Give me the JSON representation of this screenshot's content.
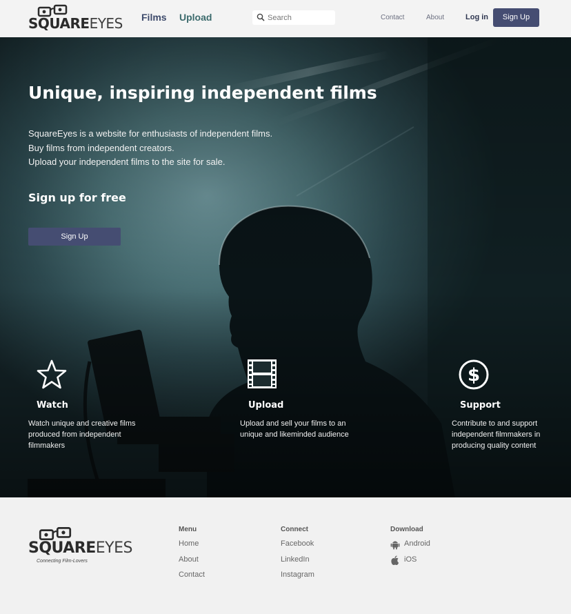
{
  "header": {
    "logo_main": "SQUARE",
    "logo_eyes": "EYES",
    "nav": {
      "films": "Films",
      "upload": "Upload"
    },
    "search": {
      "placeholder": "Search"
    },
    "links": {
      "contact": "Contact",
      "about": "About"
    },
    "login": "Log in",
    "signup": "Sign Up"
  },
  "hero": {
    "title": "Unique, inspiring independent films",
    "lines": [
      "SquareEyes is a website for enthusiasts of independent films.",
      "Buy films from independent creators.",
      "Upload your independent films to the site for sale."
    ],
    "subtitle": "Sign up for free",
    "button": "Sign Up"
  },
  "features": [
    {
      "icon": "star-icon",
      "title": "Watch",
      "desc": "Watch unique and creative films produced from independent filmmakers"
    },
    {
      "icon": "film-icon",
      "title": "Upload",
      "desc": "Upload and sell your films to an unique and likeminded audience"
    },
    {
      "icon": "dollar-icon",
      "title": "Support",
      "desc": "Contribute to and support independent filmmakers in producing quality content"
    }
  ],
  "footer": {
    "logo_main": "SQUARE",
    "logo_eyes": "EYES",
    "tagline": "Connecting Film-Lovers",
    "menu": {
      "heading": "Menu",
      "items": [
        "Home",
        "About",
        "Contact"
      ]
    },
    "connect": {
      "heading": "Connect",
      "items": [
        "Facebook",
        "LinkedIn",
        "Instagram"
      ]
    },
    "download": {
      "heading": "Download",
      "items": [
        {
          "icon": "android-icon",
          "label": "Android"
        },
        {
          "icon": "apple-icon",
          "label": "iOS"
        }
      ]
    }
  },
  "colors": {
    "accent": "#454d72",
    "films_link": "#3d4a6b",
    "upload_link": "#3b6a6c"
  }
}
